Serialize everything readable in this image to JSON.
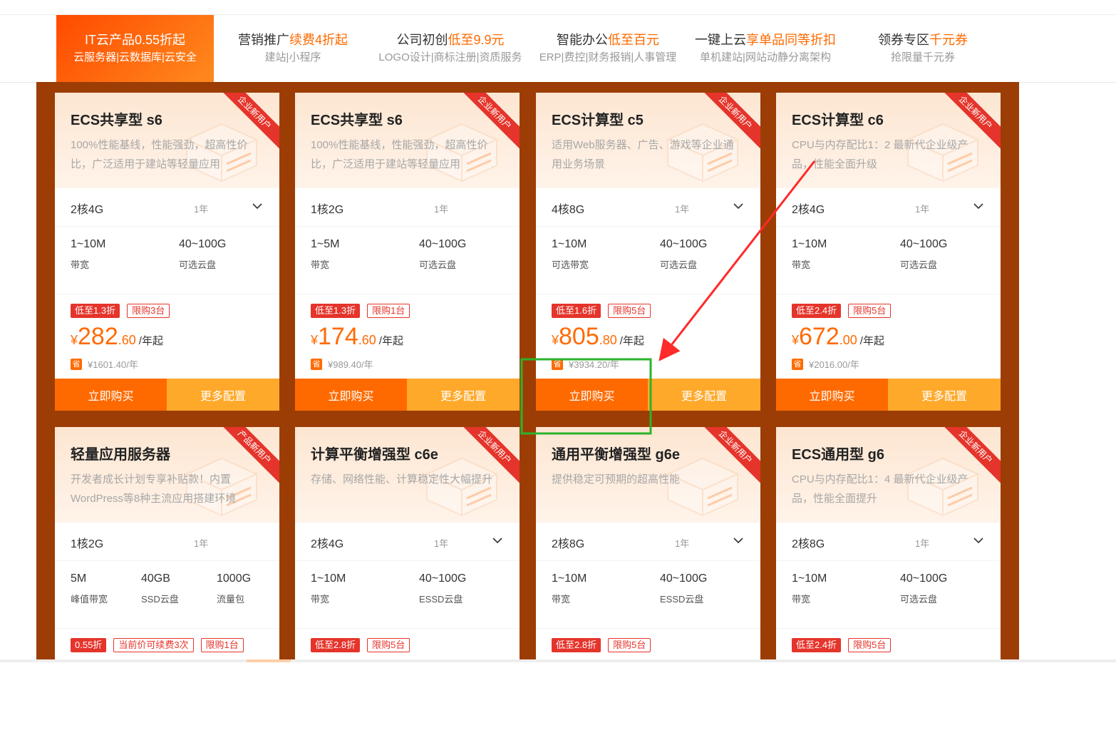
{
  "nav": {
    "items": [
      {
        "t1_pre": "IT云产品0.55折起",
        "t1_hl": "",
        "t2": "云服务器|云数据库|云安全"
      },
      {
        "t1_pre": "营销推广",
        "t1_hl": "续费4折起",
        "t2": "建站|小程序"
      },
      {
        "t1_pre": "公司初创",
        "t1_hl": "低至9.9元",
        "t2": "LOGO设计|商标注册|资质服务"
      },
      {
        "t1_pre": "智能办公",
        "t1_hl": "低至百元",
        "t2": "ERP|费控|财务报销|人事管理"
      },
      {
        "t1_pre": "一键上云",
        "t1_hl": "享单品同等折扣",
        "t2": "单机建站|网站动静分离架构"
      },
      {
        "t1_pre": "领券专区",
        "t1_hl": "千元券",
        "t2": "抢限量千元券"
      }
    ]
  },
  "cards": [
    {
      "ribbon": "企业新用户",
      "title": "ECS共享型 s6",
      "desc": "100%性能基线，性能强劲，超高性价比，广泛适用于建站等轻量应用",
      "spec": "2核4G",
      "year": "1年",
      "attrs": [
        {
          "v": "1~10M",
          "l": "带宽"
        },
        {
          "v": "40~100G",
          "l": "可选云盘"
        }
      ],
      "tags": [
        {
          "text": "低至1.3折",
          "kind": "red"
        },
        {
          "text": "限购3台",
          "kind": "out"
        }
      ],
      "cur": "¥",
      "pint": "282",
      "pdec": ".60",
      "unit": "/年起",
      "orig": "¥1601.40/年",
      "orig_icon": "省",
      "buy": "立即购买",
      "more": "更多配置"
    },
    {
      "ribbon": "企业新用户",
      "title": "ECS共享型 s6",
      "desc": "100%性能基线，性能强劲，超高性价比，广泛适用于建站等轻量应用",
      "spec": "1核2G",
      "year": "1年",
      "attrs": [
        {
          "v": "1~5M",
          "l": "带宽"
        },
        {
          "v": "40~100G",
          "l": "可选云盘"
        }
      ],
      "tags": [
        {
          "text": "低至1.3折",
          "kind": "red"
        },
        {
          "text": "限购1台",
          "kind": "out"
        }
      ],
      "cur": "¥",
      "pint": "174",
      "pdec": ".60",
      "unit": "/年起",
      "orig": "¥989.40/年",
      "orig_icon": "省",
      "buy": "立即购买",
      "more": "更多配置"
    },
    {
      "ribbon": "企业新用户",
      "title": "ECS计算型 c5",
      "desc": "适用Web服务器、广告、游戏等企业通用业务场景",
      "spec": "4核8G",
      "year": "1年",
      "attrs": [
        {
          "v": "1~10M",
          "l": "可选带宽"
        },
        {
          "v": "40~100G",
          "l": "可选云盘"
        }
      ],
      "tags": [
        {
          "text": "低至1.6折",
          "kind": "red"
        },
        {
          "text": "限购5台",
          "kind": "out"
        }
      ],
      "cur": "¥",
      "pint": "805",
      "pdec": ".80",
      "unit": "/年起",
      "orig": "¥3934.20/年",
      "orig_icon": "省",
      "buy": "立即购买",
      "more": "更多配置"
    },
    {
      "ribbon": "企业新用户",
      "title": "ECS计算型 c6",
      "desc": "CPU与内存配比1：2 最新代企业级产品，性能全面升级",
      "spec": "2核4G",
      "year": "1年",
      "attrs": [
        {
          "v": "1~10M",
          "l": "带宽"
        },
        {
          "v": "40~100G",
          "l": "可选云盘"
        }
      ],
      "tags": [
        {
          "text": "低至2.4折",
          "kind": "red"
        },
        {
          "text": "限购5台",
          "kind": "out"
        }
      ],
      "cur": "¥",
      "pint": "672",
      "pdec": ".00",
      "unit": "/年起",
      "orig": "¥2016.00/年",
      "orig_icon": "省",
      "buy": "立即购买",
      "more": "更多配置"
    },
    {
      "ribbon": "产品新用户",
      "title": "轻量应用服务器",
      "desc": "开发者成长计划专享补贴款！内置WordPress等8种主流应用搭建环境",
      "spec": "1核2G",
      "year": "1年",
      "attrs": [
        {
          "v": "5M",
          "l": "峰值带宽"
        },
        {
          "v": "40GB",
          "l": "SSD云盘"
        },
        {
          "v": "1000G",
          "l": "流量包"
        }
      ],
      "tags": [
        {
          "text": "0.55折",
          "kind": "red"
        },
        {
          "text": "当前价可续费3次",
          "kind": "out"
        },
        {
          "text": "限购1台",
          "kind": "out"
        }
      ],
      "cur": "",
      "pint": "",
      "pdec": "",
      "unit": "",
      "orig": "",
      "orig_icon": "",
      "buy": "",
      "more": ""
    },
    {
      "ribbon": "企业新用户",
      "title": "计算平衡增强型 c6e",
      "desc": "存储、网络性能、计算稳定性大幅提升",
      "spec": "2核4G",
      "year": "1年",
      "attrs": [
        {
          "v": "1~10M",
          "l": "带宽"
        },
        {
          "v": "40~100G",
          "l": "ESSD云盘"
        }
      ],
      "tags": [
        {
          "text": "低至2.8折",
          "kind": "red"
        },
        {
          "text": "限购5台",
          "kind": "out"
        }
      ],
      "cur": "",
      "pint": "",
      "pdec": "",
      "unit": "",
      "orig": "",
      "orig_icon": "",
      "buy": "",
      "more": ""
    },
    {
      "ribbon": "企业新用户",
      "title": "通用平衡增强型 g6e",
      "desc": "提供稳定可预期的超高性能",
      "spec": "2核8G",
      "year": "1年",
      "attrs": [
        {
          "v": "1~10M",
          "l": "带宽"
        },
        {
          "v": "40~100G",
          "l": "ESSD云盘"
        }
      ],
      "tags": [
        {
          "text": "低至2.8折",
          "kind": "red"
        },
        {
          "text": "限购5台",
          "kind": "out"
        }
      ],
      "cur": "",
      "pint": "",
      "pdec": "",
      "unit": "",
      "orig": "",
      "orig_icon": "",
      "buy": "",
      "more": ""
    },
    {
      "ribbon": "企业新用户",
      "title": "ECS通用型 g6",
      "desc": "CPU与内存配比1：4 最新代企业级产品，性能全面提升",
      "spec": "2核8G",
      "year": "1年",
      "attrs": [
        {
          "v": "1~10M",
          "l": "带宽"
        },
        {
          "v": "40~100G",
          "l": "可选云盘"
        }
      ],
      "tags": [
        {
          "text": "低至2.4折",
          "kind": "red"
        },
        {
          "text": "限购5台",
          "kind": "out"
        }
      ],
      "cur": "",
      "pint": "",
      "pdec": "",
      "unit": "",
      "orig": "",
      "orig_icon": "",
      "buy": "",
      "more": ""
    }
  ],
  "colors": {
    "accent": "#ff6a00",
    "accent_light": "#ffa92b",
    "panel": "#9c3d05",
    "tag_red": "#e5342b",
    "arrow": "#ff2a2a",
    "highlight_box": "#2bb32b"
  },
  "icons": {
    "chevron": "chevron-down-icon",
    "server": "server-box-icon",
    "saving": "saving-icon"
  }
}
